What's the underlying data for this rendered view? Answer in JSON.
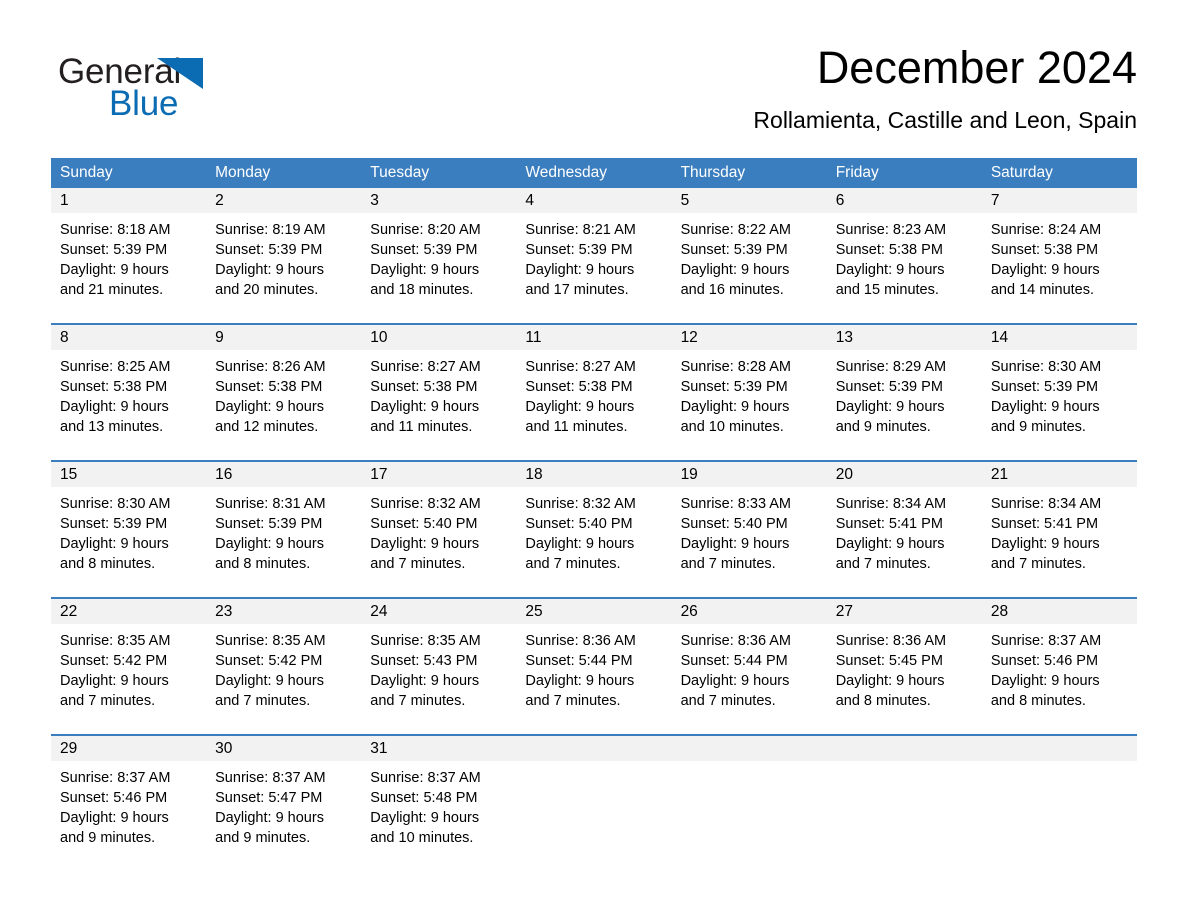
{
  "brand": {
    "name_part1": "General",
    "name_part2": "Blue",
    "logo_icon": "triangle-icon",
    "accent_color": "#0b6cb3"
  },
  "header": {
    "title": "December 2024",
    "subtitle": "Rollamienta, Castille and Leon, Spain"
  },
  "calendar": {
    "header_bg": "#3a7ebf",
    "row_divider_color": "#3a7ebf",
    "day_band_bg": "#f2f2f2",
    "weekdays": [
      "Sunday",
      "Monday",
      "Tuesday",
      "Wednesday",
      "Thursday",
      "Friday",
      "Saturday"
    ],
    "weeks": [
      [
        {
          "day": "1",
          "sunrise": "Sunrise: 8:18 AM",
          "sunset": "Sunset: 5:39 PM",
          "daylight_line1": "Daylight: 9 hours",
          "daylight_line2": "and 21 minutes."
        },
        {
          "day": "2",
          "sunrise": "Sunrise: 8:19 AM",
          "sunset": "Sunset: 5:39 PM",
          "daylight_line1": "Daylight: 9 hours",
          "daylight_line2": "and 20 minutes."
        },
        {
          "day": "3",
          "sunrise": "Sunrise: 8:20 AM",
          "sunset": "Sunset: 5:39 PM",
          "daylight_line1": "Daylight: 9 hours",
          "daylight_line2": "and 18 minutes."
        },
        {
          "day": "4",
          "sunrise": "Sunrise: 8:21 AM",
          "sunset": "Sunset: 5:39 PM",
          "daylight_line1": "Daylight: 9 hours",
          "daylight_line2": "and 17 minutes."
        },
        {
          "day": "5",
          "sunrise": "Sunrise: 8:22 AM",
          "sunset": "Sunset: 5:39 PM",
          "daylight_line1": "Daylight: 9 hours",
          "daylight_line2": "and 16 minutes."
        },
        {
          "day": "6",
          "sunrise": "Sunrise: 8:23 AM",
          "sunset": "Sunset: 5:38 PM",
          "daylight_line1": "Daylight: 9 hours",
          "daylight_line2": "and 15 minutes."
        },
        {
          "day": "7",
          "sunrise": "Sunrise: 8:24 AM",
          "sunset": "Sunset: 5:38 PM",
          "daylight_line1": "Daylight: 9 hours",
          "daylight_line2": "and 14 minutes."
        }
      ],
      [
        {
          "day": "8",
          "sunrise": "Sunrise: 8:25 AM",
          "sunset": "Sunset: 5:38 PM",
          "daylight_line1": "Daylight: 9 hours",
          "daylight_line2": "and 13 minutes."
        },
        {
          "day": "9",
          "sunrise": "Sunrise: 8:26 AM",
          "sunset": "Sunset: 5:38 PM",
          "daylight_line1": "Daylight: 9 hours",
          "daylight_line2": "and 12 minutes."
        },
        {
          "day": "10",
          "sunrise": "Sunrise: 8:27 AM",
          "sunset": "Sunset: 5:38 PM",
          "daylight_line1": "Daylight: 9 hours",
          "daylight_line2": "and 11 minutes."
        },
        {
          "day": "11",
          "sunrise": "Sunrise: 8:27 AM",
          "sunset": "Sunset: 5:38 PM",
          "daylight_line1": "Daylight: 9 hours",
          "daylight_line2": "and 11 minutes."
        },
        {
          "day": "12",
          "sunrise": "Sunrise: 8:28 AM",
          "sunset": "Sunset: 5:39 PM",
          "daylight_line1": "Daylight: 9 hours",
          "daylight_line2": "and 10 minutes."
        },
        {
          "day": "13",
          "sunrise": "Sunrise: 8:29 AM",
          "sunset": "Sunset: 5:39 PM",
          "daylight_line1": "Daylight: 9 hours",
          "daylight_line2": "and 9 minutes."
        },
        {
          "day": "14",
          "sunrise": "Sunrise: 8:30 AM",
          "sunset": "Sunset: 5:39 PM",
          "daylight_line1": "Daylight: 9 hours",
          "daylight_line2": "and 9 minutes."
        }
      ],
      [
        {
          "day": "15",
          "sunrise": "Sunrise: 8:30 AM",
          "sunset": "Sunset: 5:39 PM",
          "daylight_line1": "Daylight: 9 hours",
          "daylight_line2": "and 8 minutes."
        },
        {
          "day": "16",
          "sunrise": "Sunrise: 8:31 AM",
          "sunset": "Sunset: 5:39 PM",
          "daylight_line1": "Daylight: 9 hours",
          "daylight_line2": "and 8 minutes."
        },
        {
          "day": "17",
          "sunrise": "Sunrise: 8:32 AM",
          "sunset": "Sunset: 5:40 PM",
          "daylight_line1": "Daylight: 9 hours",
          "daylight_line2": "and 7 minutes."
        },
        {
          "day": "18",
          "sunrise": "Sunrise: 8:32 AM",
          "sunset": "Sunset: 5:40 PM",
          "daylight_line1": "Daylight: 9 hours",
          "daylight_line2": "and 7 minutes."
        },
        {
          "day": "19",
          "sunrise": "Sunrise: 8:33 AM",
          "sunset": "Sunset: 5:40 PM",
          "daylight_line1": "Daylight: 9 hours",
          "daylight_line2": "and 7 minutes."
        },
        {
          "day": "20",
          "sunrise": "Sunrise: 8:34 AM",
          "sunset": "Sunset: 5:41 PM",
          "daylight_line1": "Daylight: 9 hours",
          "daylight_line2": "and 7 minutes."
        },
        {
          "day": "21",
          "sunrise": "Sunrise: 8:34 AM",
          "sunset": "Sunset: 5:41 PM",
          "daylight_line1": "Daylight: 9 hours",
          "daylight_line2": "and 7 minutes."
        }
      ],
      [
        {
          "day": "22",
          "sunrise": "Sunrise: 8:35 AM",
          "sunset": "Sunset: 5:42 PM",
          "daylight_line1": "Daylight: 9 hours",
          "daylight_line2": "and 7 minutes."
        },
        {
          "day": "23",
          "sunrise": "Sunrise: 8:35 AM",
          "sunset": "Sunset: 5:42 PM",
          "daylight_line1": "Daylight: 9 hours",
          "daylight_line2": "and 7 minutes."
        },
        {
          "day": "24",
          "sunrise": "Sunrise: 8:35 AM",
          "sunset": "Sunset: 5:43 PM",
          "daylight_line1": "Daylight: 9 hours",
          "daylight_line2": "and 7 minutes."
        },
        {
          "day": "25",
          "sunrise": "Sunrise: 8:36 AM",
          "sunset": "Sunset: 5:44 PM",
          "daylight_line1": "Daylight: 9 hours",
          "daylight_line2": "and 7 minutes."
        },
        {
          "day": "26",
          "sunrise": "Sunrise: 8:36 AM",
          "sunset": "Sunset: 5:44 PM",
          "daylight_line1": "Daylight: 9 hours",
          "daylight_line2": "and 7 minutes."
        },
        {
          "day": "27",
          "sunrise": "Sunrise: 8:36 AM",
          "sunset": "Sunset: 5:45 PM",
          "daylight_line1": "Daylight: 9 hours",
          "daylight_line2": "and 8 minutes."
        },
        {
          "day": "28",
          "sunrise": "Sunrise: 8:37 AM",
          "sunset": "Sunset: 5:46 PM",
          "daylight_line1": "Daylight: 9 hours",
          "daylight_line2": "and 8 minutes."
        }
      ],
      [
        {
          "day": "29",
          "sunrise": "Sunrise: 8:37 AM",
          "sunset": "Sunset: 5:46 PM",
          "daylight_line1": "Daylight: 9 hours",
          "daylight_line2": "and 9 minutes."
        },
        {
          "day": "30",
          "sunrise": "Sunrise: 8:37 AM",
          "sunset": "Sunset: 5:47 PM",
          "daylight_line1": "Daylight: 9 hours",
          "daylight_line2": "and 9 minutes."
        },
        {
          "day": "31",
          "sunrise": "Sunrise: 8:37 AM",
          "sunset": "Sunset: 5:48 PM",
          "daylight_line1": "Daylight: 9 hours",
          "daylight_line2": "and 10 minutes."
        },
        {
          "day": "",
          "sunrise": "",
          "sunset": "",
          "daylight_line1": "",
          "daylight_line2": ""
        },
        {
          "day": "",
          "sunrise": "",
          "sunset": "",
          "daylight_line1": "",
          "daylight_line2": ""
        },
        {
          "day": "",
          "sunrise": "",
          "sunset": "",
          "daylight_line1": "",
          "daylight_line2": ""
        },
        {
          "day": "",
          "sunrise": "",
          "sunset": "",
          "daylight_line1": "",
          "daylight_line2": ""
        }
      ]
    ]
  }
}
